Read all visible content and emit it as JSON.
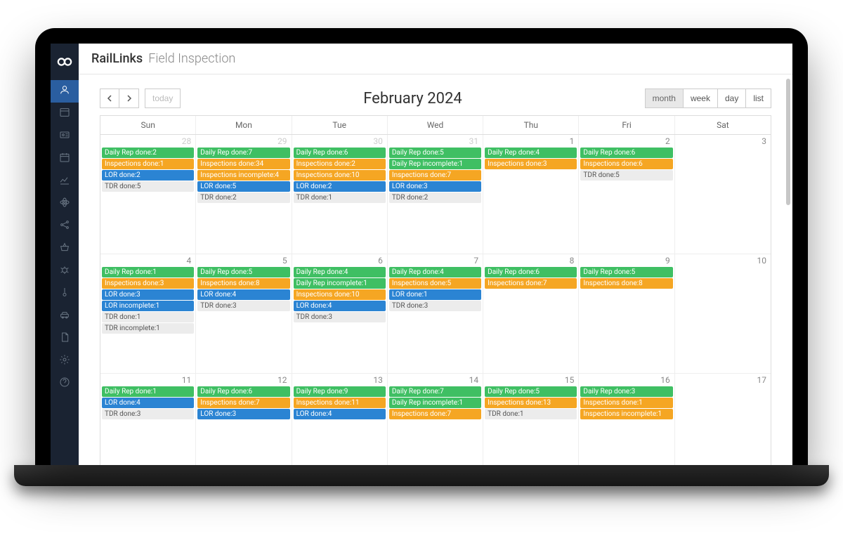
{
  "brand": "RailLinks",
  "subtitle": "Field Inspection",
  "calendar_title": "February 2024",
  "toolbar": {
    "today": "today",
    "views": [
      "month",
      "week",
      "day",
      "list"
    ],
    "active_view": "month"
  },
  "day_headers": [
    "Sun",
    "Mon",
    "Tue",
    "Wed",
    "Thu",
    "Fri",
    "Sat"
  ],
  "sidebar_icons": [
    "user",
    "window",
    "id-card",
    "calendar",
    "chart",
    "atom",
    "share",
    "basket",
    "bug",
    "thermometer",
    "car",
    "file",
    "gear",
    "help"
  ],
  "colors": {
    "green": "#3fbf63",
    "orange": "#f5a623",
    "blue": "#2b84d3",
    "gray": "#ececec"
  },
  "weeks": [
    [
      {
        "date": 28,
        "other": true,
        "events": [
          {
            "c": "green",
            "t": "Daily Rep done:2"
          },
          {
            "c": "orange",
            "t": "Inspections done:1"
          },
          {
            "c": "blue",
            "t": "LOR done:2"
          },
          {
            "c": "gray",
            "t": "TDR done:5"
          }
        ]
      },
      {
        "date": 29,
        "other": true,
        "events": [
          {
            "c": "green",
            "t": "Daily Rep done:7"
          },
          {
            "c": "orange",
            "t": "Inspections done:34"
          },
          {
            "c": "orange",
            "t": "Inspections incomplete:4"
          },
          {
            "c": "blue",
            "t": "LOR done:5"
          },
          {
            "c": "gray",
            "t": "TDR done:2"
          }
        ]
      },
      {
        "date": 30,
        "other": true,
        "events": [
          {
            "c": "green",
            "t": "Daily Rep done:6"
          },
          {
            "c": "orange",
            "t": "Inspections done:2"
          },
          {
            "c": "orange",
            "t": "Inspections done:10"
          },
          {
            "c": "blue",
            "t": "LOR done:2"
          },
          {
            "c": "gray",
            "t": "TDR done:1"
          }
        ]
      },
      {
        "date": 31,
        "other": true,
        "events": [
          {
            "c": "green",
            "t": "Daily Rep done:5"
          },
          {
            "c": "green",
            "t": "Daily Rep incomplete:1"
          },
          {
            "c": "orange",
            "t": "Inspections done:7"
          },
          {
            "c": "blue",
            "t": "LOR done:3"
          },
          {
            "c": "gray",
            "t": "TDR done:2"
          }
        ]
      },
      {
        "date": 1,
        "events": [
          {
            "c": "green",
            "t": "Daily Rep done:4"
          },
          {
            "c": "orange",
            "t": "Inspections done:3"
          }
        ]
      },
      {
        "date": 2,
        "events": [
          {
            "c": "green",
            "t": "Daily Rep done:6"
          },
          {
            "c": "orange",
            "t": "Inspections done:6"
          },
          {
            "c": "gray",
            "t": "TDR done:5"
          }
        ]
      },
      {
        "date": 3,
        "events": []
      }
    ],
    [
      {
        "date": 4,
        "events": [
          {
            "c": "green",
            "t": "Daily Rep done:1"
          },
          {
            "c": "orange",
            "t": "Inspections done:3"
          },
          {
            "c": "blue",
            "t": "LOR done:3"
          },
          {
            "c": "blue",
            "t": "LOR incomplete:1"
          },
          {
            "c": "gray",
            "t": "TDR done:1"
          },
          {
            "c": "gray",
            "t": "TDR incomplete:1"
          }
        ]
      },
      {
        "date": 5,
        "events": [
          {
            "c": "green",
            "t": "Daily Rep done:5"
          },
          {
            "c": "orange",
            "t": "Inspections done:8"
          },
          {
            "c": "blue",
            "t": "LOR done:4"
          },
          {
            "c": "gray",
            "t": "TDR done:3"
          }
        ]
      },
      {
        "date": 6,
        "events": [
          {
            "c": "green",
            "t": "Daily Rep done:4"
          },
          {
            "c": "green",
            "t": "Daily Rep incomplete:1"
          },
          {
            "c": "orange",
            "t": "Inspections done:10"
          },
          {
            "c": "blue",
            "t": "LOR done:4"
          },
          {
            "c": "gray",
            "t": "TDR done:3"
          }
        ]
      },
      {
        "date": 7,
        "events": [
          {
            "c": "green",
            "t": "Daily Rep done:4"
          },
          {
            "c": "orange",
            "t": "Inspections done:5"
          },
          {
            "c": "blue",
            "t": "LOR done:1"
          },
          {
            "c": "gray",
            "t": "TDR done:3"
          }
        ]
      },
      {
        "date": 8,
        "events": [
          {
            "c": "green",
            "t": "Daily Rep done:6"
          },
          {
            "c": "orange",
            "t": "Inspections done:7"
          }
        ]
      },
      {
        "date": 9,
        "events": [
          {
            "c": "green",
            "t": "Daily Rep done:5"
          },
          {
            "c": "orange",
            "t": "Inspections done:8"
          }
        ]
      },
      {
        "date": 10,
        "events": []
      }
    ],
    [
      {
        "date": 11,
        "events": [
          {
            "c": "green",
            "t": "Daily Rep done:1"
          },
          {
            "c": "blue",
            "t": "LOR done:4"
          },
          {
            "c": "gray",
            "t": "TDR done:3"
          }
        ]
      },
      {
        "date": 12,
        "events": [
          {
            "c": "green",
            "t": "Daily Rep done:6"
          },
          {
            "c": "orange",
            "t": "Inspections done:7"
          },
          {
            "c": "blue",
            "t": "LOR done:3"
          }
        ]
      },
      {
        "date": 13,
        "events": [
          {
            "c": "green",
            "t": "Daily Rep done:9"
          },
          {
            "c": "orange",
            "t": "Inspections done:11"
          },
          {
            "c": "blue",
            "t": "LOR done:4"
          }
        ]
      },
      {
        "date": 14,
        "events": [
          {
            "c": "green",
            "t": "Daily Rep done:7"
          },
          {
            "c": "green",
            "t": "Daily Rep incomplete:1"
          },
          {
            "c": "orange",
            "t": "Inspections done:7"
          }
        ]
      },
      {
        "date": 15,
        "events": [
          {
            "c": "green",
            "t": "Daily Rep done:5"
          },
          {
            "c": "orange",
            "t": "Inspections done:13"
          },
          {
            "c": "gray",
            "t": "TDR done:1"
          }
        ]
      },
      {
        "date": 16,
        "events": [
          {
            "c": "green",
            "t": "Daily Rep done:3"
          },
          {
            "c": "orange",
            "t": "Inspections done:1"
          },
          {
            "c": "orange",
            "t": "Inspections incomplete:1"
          }
        ]
      },
      {
        "date": 17,
        "events": []
      }
    ]
  ]
}
